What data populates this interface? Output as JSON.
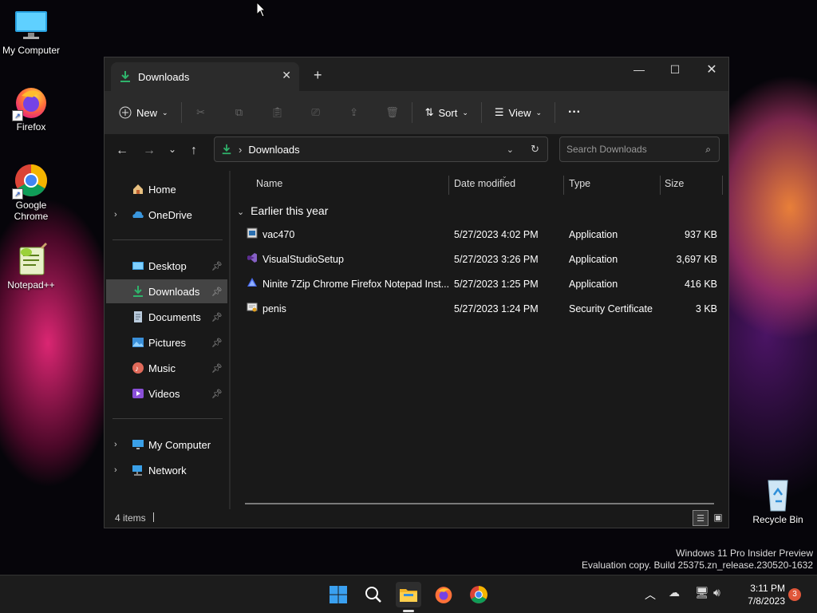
{
  "desktop": {
    "icons": [
      {
        "label": "My Computer"
      },
      {
        "label": "Firefox"
      },
      {
        "label": "Google Chrome"
      },
      {
        "label": "Notepad++"
      },
      {
        "label": "Recycle Bin"
      }
    ],
    "watermark_line1": "Windows 11 Pro Insider Preview",
    "watermark_line2": "Evaluation copy. Build 25375.zn_release.230520-1632"
  },
  "window": {
    "tab_title": "Downloads",
    "new_tab": "+",
    "commandbar": {
      "new_label": "New",
      "sort_label": "Sort",
      "view_label": "View",
      "more_label": "···"
    },
    "address": {
      "path": "Downloads",
      "search_placeholder": "Search Downloads"
    },
    "sidebar": {
      "items": [
        {
          "label": "Home"
        },
        {
          "label": "OneDrive"
        },
        {
          "label": "Desktop"
        },
        {
          "label": "Downloads"
        },
        {
          "label": "Documents"
        },
        {
          "label": "Pictures"
        },
        {
          "label": "Music"
        },
        {
          "label": "Videos"
        },
        {
          "label": "My Computer"
        },
        {
          "label": "Network"
        }
      ]
    },
    "columns": {
      "name": "Name",
      "date": "Date modified",
      "type": "Type",
      "size": "Size"
    },
    "group_label": "Earlier this year",
    "files": [
      {
        "name": "vac470",
        "date": "5/27/2023 4:02 PM",
        "type": "Application",
        "size": "937 KB"
      },
      {
        "name": "VisualStudioSetup",
        "date": "5/27/2023 3:26 PM",
        "type": "Application",
        "size": "3,697 KB"
      },
      {
        "name": "Ninite 7Zip Chrome Firefox Notepad Inst...",
        "date": "5/27/2023 1:25 PM",
        "type": "Application",
        "size": "416 KB"
      },
      {
        "name": "penis",
        "date": "5/27/2023 1:24 PM",
        "type": "Security Certificate",
        "size": "3 KB"
      }
    ],
    "status": "4 items"
  },
  "taskbar": {
    "time": "3:11 PM",
    "date": "7/8/2023",
    "notification_count": "3"
  },
  "colors": {
    "accent_blue": "#0078d4",
    "download_green": "#2fb36b",
    "selected_bg": "#444444"
  }
}
